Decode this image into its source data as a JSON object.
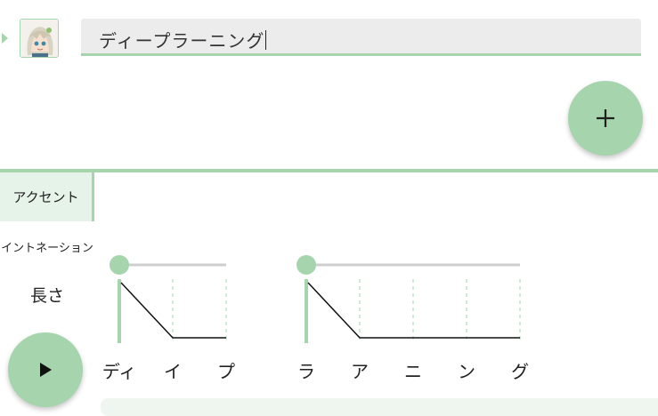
{
  "text_input": {
    "value": "ディープラーニング"
  },
  "tabs": [
    {
      "label": "アクセント",
      "selected": true
    },
    {
      "label": "イントネーション",
      "selected": false
    },
    {
      "label": "長さ",
      "selected": false
    }
  ],
  "add_button": {
    "icon": "plus-icon"
  },
  "play_button": {
    "icon": "play-icon"
  },
  "accent_groups": [
    {
      "moras": [
        "ディ",
        "イ",
        "プ"
      ],
      "accent": 1
    },
    {
      "moras": [
        "ラ",
        "ア",
        "ニ",
        "ン",
        "グ"
      ],
      "accent": 1
    }
  ],
  "colors": {
    "accent": "#a5d4ad",
    "accent_light": "#e6f3e8",
    "field_bg": "#ececec"
  }
}
